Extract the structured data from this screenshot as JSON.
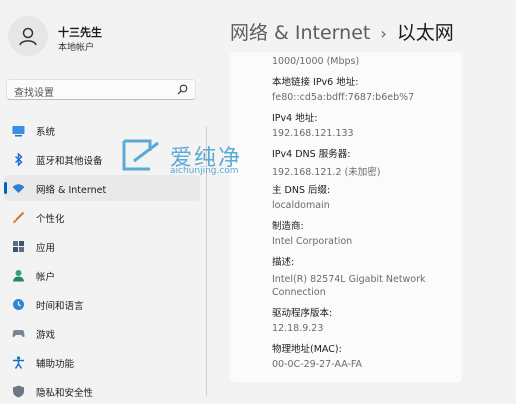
{
  "user": {
    "name": "十三先生",
    "account_type": "本地帐户"
  },
  "search": {
    "placeholder": "查找设置"
  },
  "nav": {
    "items": [
      {
        "label": "系统"
      },
      {
        "label": "蓝牙和其他设备"
      },
      {
        "label": "网络 & Internet",
        "active": true
      },
      {
        "label": "个性化"
      },
      {
        "label": "应用"
      },
      {
        "label": "帐户"
      },
      {
        "label": "时间和语言"
      },
      {
        "label": "游戏"
      },
      {
        "label": "辅助功能"
      },
      {
        "label": "隐私和安全性"
      }
    ]
  },
  "header": {
    "parent": "网络 & Internet",
    "separator": "›",
    "title": "以太网"
  },
  "details": {
    "link_speed_value": "1000/1000 (Mbps)",
    "ipv6_label": "本地链接 IPv6 地址:",
    "ipv6_value": "fe80::cd5a:bdff:7687:b6eb%7",
    "ipv4_label": "IPv4 地址:",
    "ipv4_value": "192.168.121.133",
    "dns_label": "IPv4 DNS 服务器:",
    "dns_value": "192.168.121.2 (未加密)",
    "dns_suffix_label": "主 DNS 后缀:",
    "dns_suffix_value": "localdomain",
    "manufacturer_label": "制造商:",
    "manufacturer_value": "Intel Corporation",
    "description_label": "描述:",
    "description_value": "Intel(R) 82574L Gigabit Network Connection",
    "driver_label": "驱动程序版本:",
    "driver_value": "12.18.9.23",
    "mac_label": "物理地址(MAC):",
    "mac_value": "00-0C-29-27-AA-FA"
  },
  "watermark": {
    "text": "爱纯净",
    "url": "aichunjing.com"
  },
  "colors": {
    "accent": "#0067c0",
    "watermark": "#5aa9d6"
  }
}
